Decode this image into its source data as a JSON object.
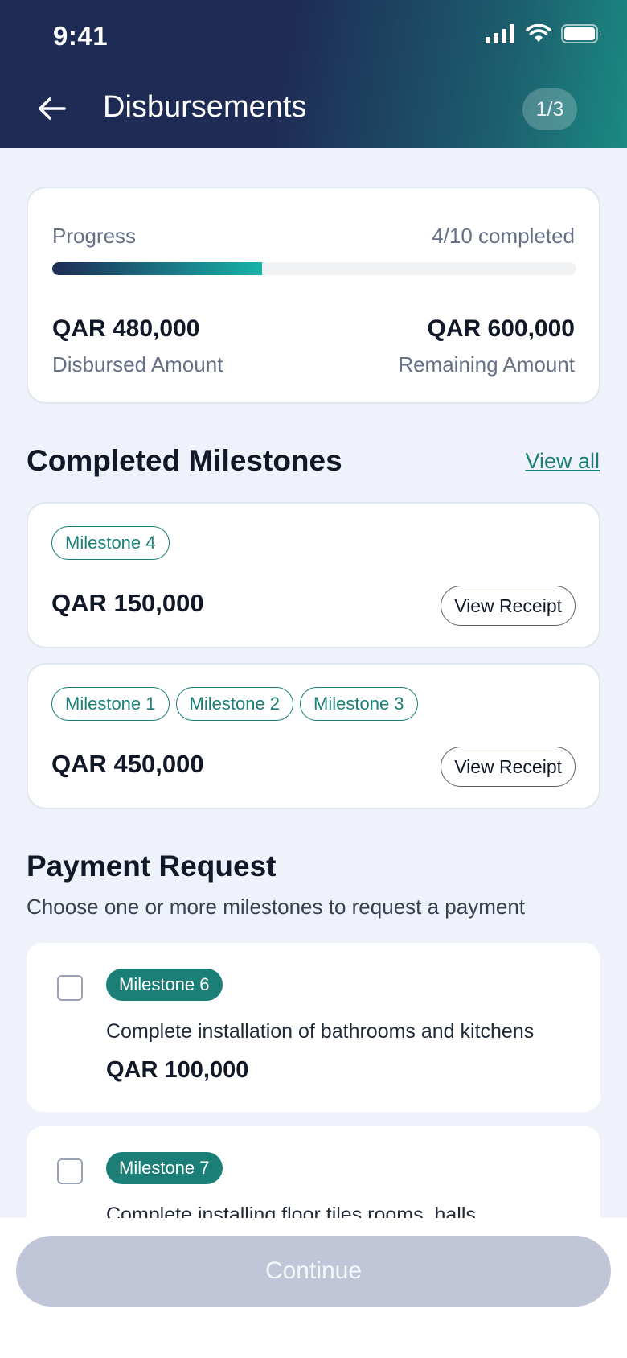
{
  "status_bar": {
    "time": "9:41"
  },
  "header": {
    "title": "Disbursements",
    "step": "1/3"
  },
  "progress": {
    "label": "Progress",
    "completed_text": "4/10 completed",
    "fraction": 0.4,
    "disbursed_amount": "QAR 480,000",
    "disbursed_label": "Disbursed Amount",
    "remaining_amount": "QAR 600,000",
    "remaining_label": "Remaining Amount"
  },
  "completed_milestones": {
    "title": "Completed Milestones",
    "view_all": "View all",
    "items": [
      {
        "tags": [
          "Milestone 4"
        ],
        "amount": "QAR 150,000",
        "button": "View Receipt"
      },
      {
        "tags": [
          "Milestone 1",
          "Milestone 2",
          "Milestone 3"
        ],
        "amount": "QAR 450,000",
        "button": "View Receipt"
      }
    ]
  },
  "payment_request": {
    "title": "Payment Request",
    "subtitle": "Choose one or more milestones to request a payment",
    "items": [
      {
        "tag": "Milestone 6",
        "description": "Complete installation of bathrooms and kitchens",
        "amount": "QAR 100,000",
        "checked": false
      },
      {
        "tag": "Milestone 7",
        "description": "Complete installing floor tiles rooms, halls",
        "checked": false
      }
    ]
  },
  "footer": {
    "continue_label": "Continue"
  },
  "colors": {
    "accent": "#1b7f77",
    "header_dark": "#1e2b55",
    "disabled_button": "#c0c6d8"
  }
}
